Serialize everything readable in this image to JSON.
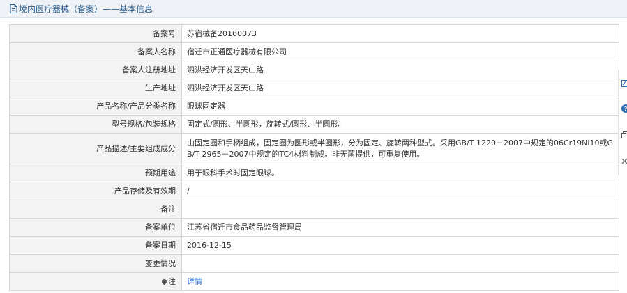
{
  "header": {
    "title": "境内医疗器械（备案）——基本信息"
  },
  "rows": [
    {
      "label": "备案号",
      "value": "苏宿械备20160073"
    },
    {
      "label": "备案人名称",
      "value": "宿迁市正通医疗器械有限公司"
    },
    {
      "label": "备案人注册地址",
      "value": "泗洪经济开发区天山路"
    },
    {
      "label": "生产地址",
      "value": "泗洪经济开发区天山路"
    },
    {
      "label": "产品名称/产品分类名称",
      "value": "眼球固定器"
    },
    {
      "label": "型号规格/包装规格",
      "value": "固定式/圆形、半圆形，旋转式/圆形、半圆形。"
    },
    {
      "label": "产品描述/主要组成成分",
      "value": "由固定圈和手柄组成，固定圈为圆形或半圆形，分为固定、旋转两种型式。采用GB/T 1220－2007中规定的06Cr19Ni10或GB/T 2965－2007中规定的TC4材料制成。非无菌提供，可重复使用。"
    },
    {
      "label": "预期用途",
      "value": "用于眼科手术时固定眼球。"
    },
    {
      "label": "产品存储及有效期",
      "value": "/"
    },
    {
      "label": "备注",
      "value": ""
    },
    {
      "label": "备案单位",
      "value": "江苏省宿迁市食品药品监督管理局"
    },
    {
      "label": "备案日期",
      "value": "2016-12-15"
    },
    {
      "label": "变更情况",
      "value": ""
    }
  ],
  "note": {
    "label": "注",
    "link": "详情"
  },
  "icons": {
    "header": "document-icon",
    "note": "map-pin-icon",
    "side": [
      "edit-icon",
      "help-icon",
      "copy-icon",
      "close-icon"
    ]
  },
  "colors": {
    "title": "#2f5f8f",
    "link": "#3a7bd5",
    "help": "#2f6db5"
  }
}
